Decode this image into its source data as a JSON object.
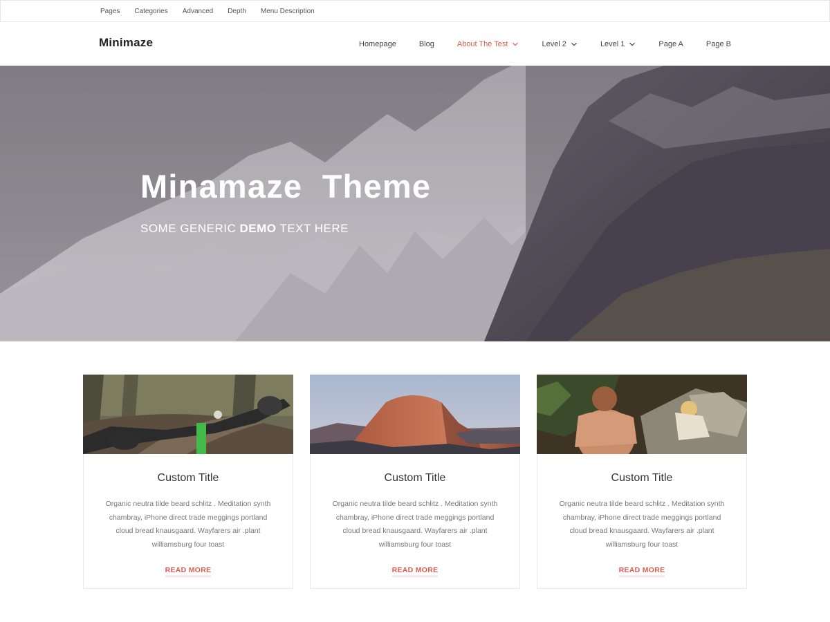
{
  "topbar": {
    "links": [
      "Pages",
      "Categories",
      "Advanced",
      "Depth",
      "Menu Description"
    ]
  },
  "header": {
    "brand": "Minimaze",
    "nav": [
      {
        "label": "Homepage",
        "dropdown": false,
        "active": false
      },
      {
        "label": "Blog",
        "dropdown": false,
        "active": false
      },
      {
        "label": "About The Test",
        "dropdown": true,
        "active": true
      },
      {
        "label": "Level 2",
        "dropdown": true,
        "active": false
      },
      {
        "label": "Level 1",
        "dropdown": true,
        "active": false
      },
      {
        "label": "Page A",
        "dropdown": false,
        "active": false
      },
      {
        "label": "Page B",
        "dropdown": false,
        "active": false
      }
    ]
  },
  "hero": {
    "title": "Minamaze  Theme",
    "subtitle_pre": "SOME GENERIC ",
    "subtitle_bold": "DEMO",
    "subtitle_post": " TEXT HERE"
  },
  "cards": [
    {
      "image": "mountain-bike-photo",
      "title": "Custom Title",
      "text": "Organic neutra tilde beard schlitz . Meditation synth chambray, iPhone direct trade meggings portland cloud bread knausgaard. Wayfarers air .plant williamsburg four toast",
      "link": "READ MORE"
    },
    {
      "image": "mountain-peak-photo",
      "title": "Custom Title",
      "text": "Organic neutra tilde beard schlitz . Meditation synth chambray, iPhone direct trade meggings portland cloud bread knausgaard. Wayfarers air .plant williamsburg four toast",
      "link": "READ MORE"
    },
    {
      "image": "climbers-photo",
      "title": "Custom Title",
      "text": "Organic neutra tilde beard schlitz . Meditation synth chambray, iPhone direct trade meggings portland cloud bread knausgaard. Wayfarers air .plant williamsburg four toast",
      "link": "READ MORE"
    }
  ],
  "colors": {
    "accent": "#e05a4f",
    "text": "#333333",
    "muted": "#777777"
  }
}
